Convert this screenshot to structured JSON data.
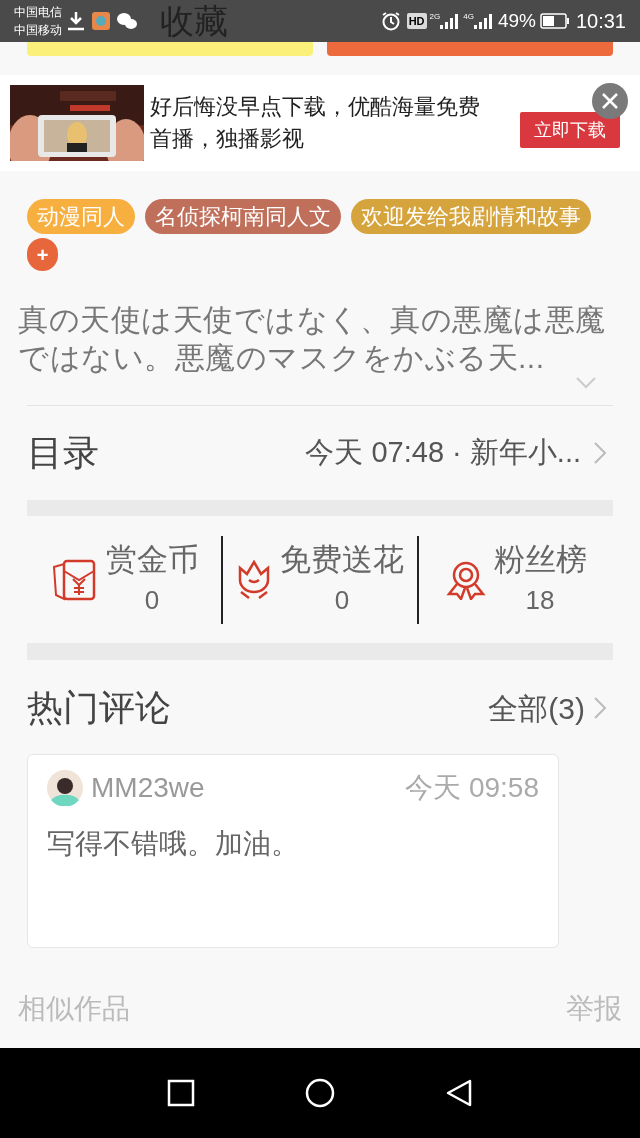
{
  "status_bar": {
    "carriers": [
      "中国电信",
      "中国移动"
    ],
    "hd": "HD",
    "network_1": "2G",
    "network_2": "4G",
    "battery": "49%",
    "time": "10:31"
  },
  "top_buttons": [
    {
      "kind": "collect",
      "label": "收藏"
    },
    {
      "kind": "continue"
    }
  ],
  "ad": {
    "text": "好后悔没早点下载，优酷海量免费首播，独播影视",
    "button": "立即下载"
  },
  "tags": [
    {
      "label": "动漫同人",
      "color": "#f7b040"
    },
    {
      "label": "名侦探柯南同人文",
      "color": "#c0705a"
    },
    {
      "label": "欢迎发给我剧情和故事",
      "color": "#d6a43c"
    }
  ],
  "add_tag": "+",
  "synopsis": "真の天使は天使ではなく、真の悪魔は悪魔ではない。悪魔のマスクをかぶる天...",
  "catalog": {
    "label": "目录",
    "latest": "今天 07:48 · 新年小..."
  },
  "stats": [
    {
      "kind": "coin",
      "label": "赏金币",
      "value": "0"
    },
    {
      "kind": "flower",
      "label": "免费送花",
      "value": "0"
    },
    {
      "kind": "fans",
      "label": "粉丝榜",
      "value": "18"
    }
  ],
  "comments_section": {
    "title": "热门评论",
    "all": "全部(3)"
  },
  "comments": [
    {
      "user": "MM23we",
      "time": "今天 09:58",
      "text": "写得不错哦。加油。"
    }
  ],
  "footer": {
    "similar": "相似作品",
    "report": "举报"
  }
}
